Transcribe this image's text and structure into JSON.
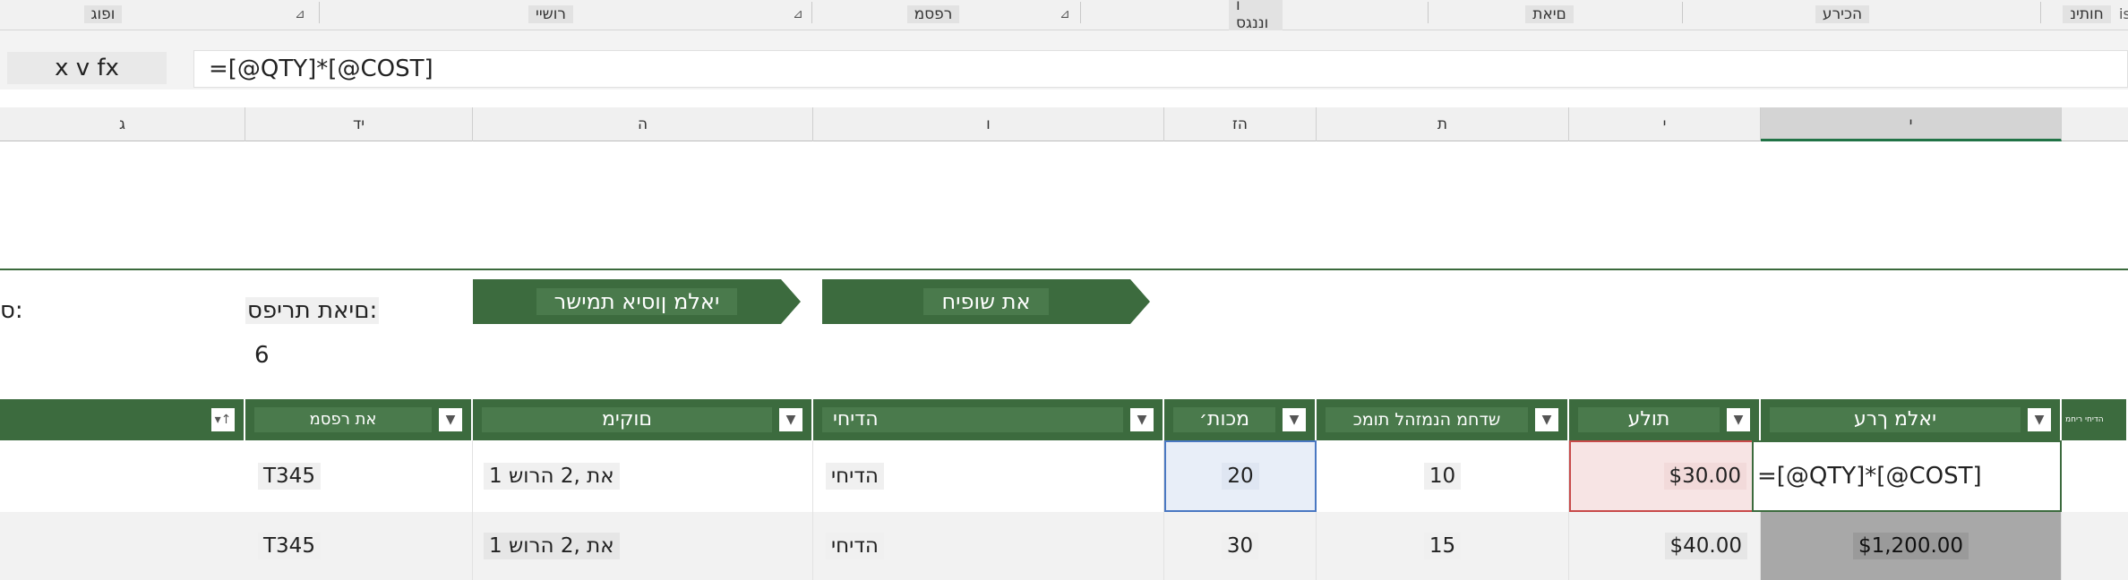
{
  "ribbon": {
    "groups": [
      "ופוג",
      "רושיי",
      "רפסמ",
      "ı וננגס",
      "םיאת",
      "הכירע",
      "חותינ"
    ],
    "edge_text": "is"
  },
  "formula_bar": {
    "name_box": "x v fx",
    "formula": "=[@QTY]*[@COST]"
  },
  "columns": [
    "ג",
    "יד",
    "ה",
    "ו",
    "הז",
    "ת",
    "י",
    "י"
  ],
  "buttons": {
    "left": "יאלמ ןוסיא תמישר",
    "right": "את שופיח"
  },
  "labels": {
    "left_colon": "ס:",
    "total_label": "םיאת תריפס:",
    "count": "6"
  },
  "table": {
    "headers": [
      "את רפסמ",
      "םוקימ",
      "הדיחי",
      "מכות׳",
      "שדחמ הנמזהל תומכ",
      "תולע",
      "יאלמ ךרע",
      "הדיחי ריחמ"
    ],
    "rows": [
      [
        "T345",
        "1 את ,2 הרוש",
        "הדיחי",
        "20",
        "10",
        "$30.00",
        "=[@QTY]*[@COST]"
      ],
      [
        "T345",
        "1 את ,2 הרוש",
        "הדיחי",
        "30",
        "15",
        "$40.00",
        "$1,200.00"
      ]
    ]
  },
  "colors": {
    "accent_green": "#3c6b3e",
    "selected_blue": "#e8eef8",
    "error_red": "#f7e4e4"
  }
}
